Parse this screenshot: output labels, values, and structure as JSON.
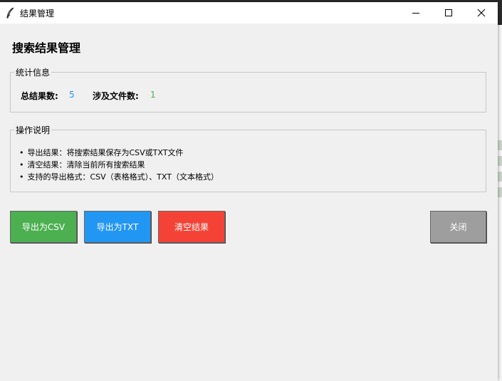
{
  "window": {
    "title": "结果管理"
  },
  "heading": "搜索结果管理",
  "stats": {
    "group_title": "统计信息",
    "total_label": "总结果数:",
    "total_value": "5",
    "files_label": "涉及文件数:",
    "files_value": "1"
  },
  "instructions": {
    "group_title": "操作说明",
    "items": [
      "导出结果：将搜索结果保存为CSV或TXT文件",
      "清空结果：清除当前所有搜索结果",
      "支持的导出格式：CSV（表格格式）、TXT（文本格式）"
    ]
  },
  "buttons": {
    "export_csv": "导出为CSV",
    "export_txt": "导出为TXT",
    "clear": "清空结果",
    "close": "关闭"
  },
  "colors": {
    "export_csv": "#4caf50",
    "export_txt": "#2196f3",
    "clear": "#f44336",
    "close": "#9e9e9e",
    "total_value": "#2196f3",
    "files_value": "#4caf50"
  },
  "icons": {
    "app": "feather-icon",
    "minimize": "minimize-icon",
    "maximize": "maximize-icon",
    "close": "close-icon"
  }
}
